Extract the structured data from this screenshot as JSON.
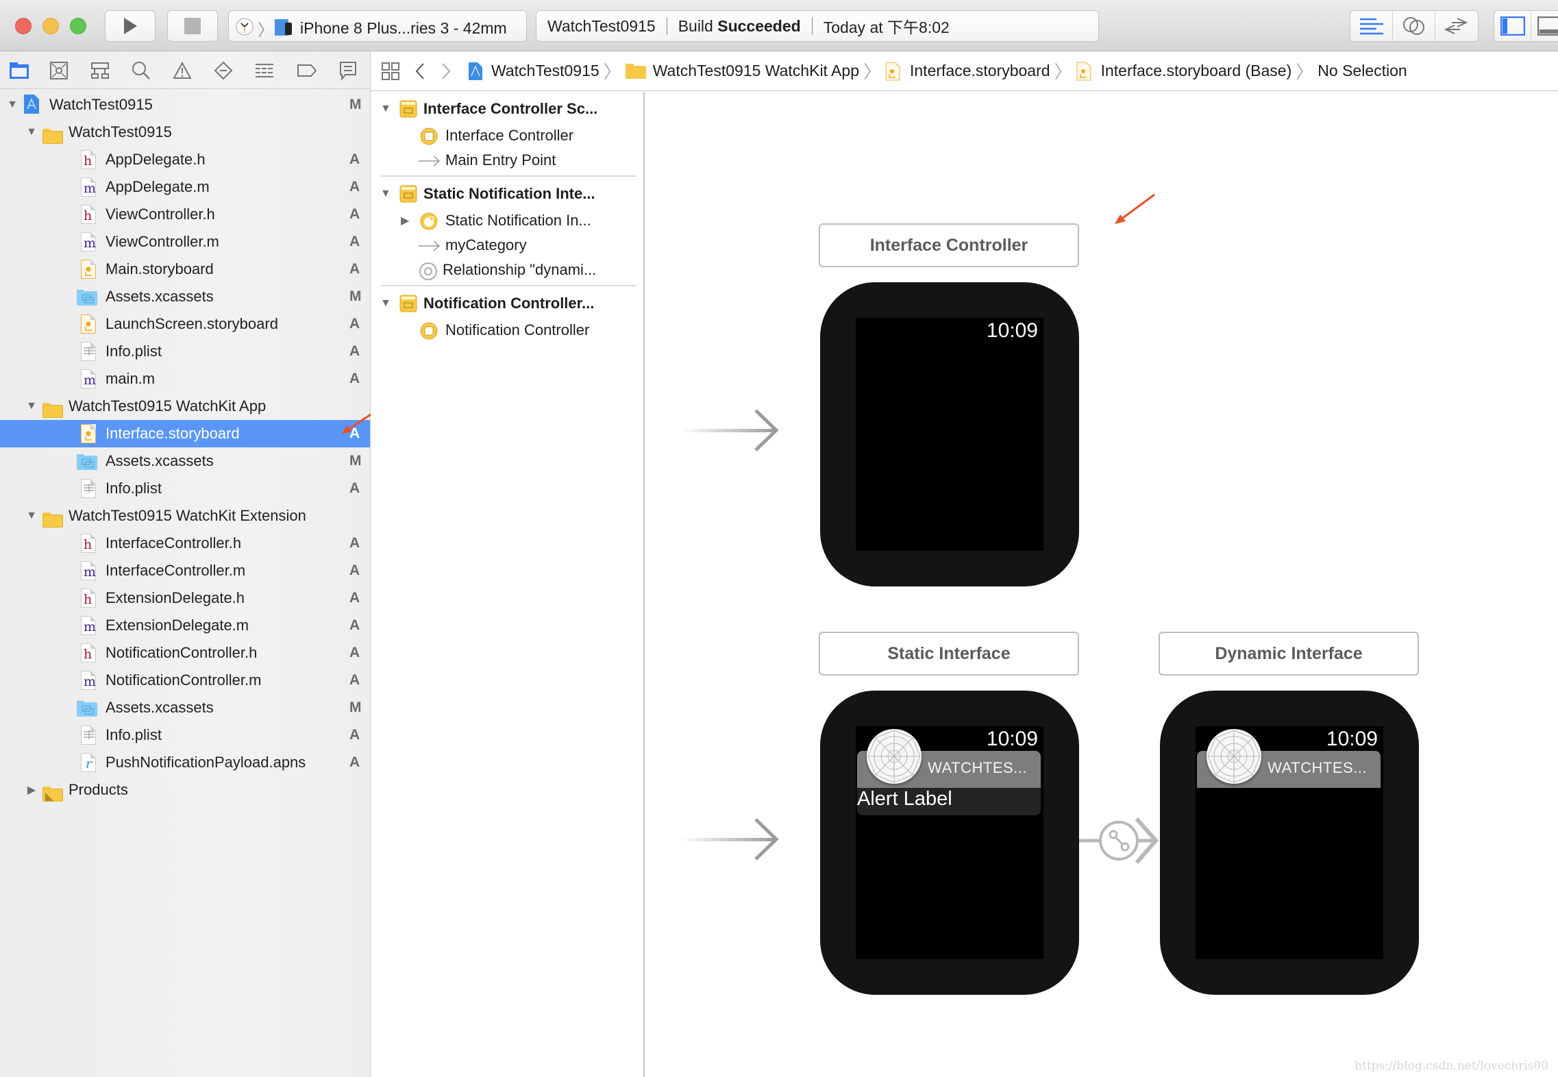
{
  "toolbar": {
    "window_controls": [
      "close",
      "minimize",
      "zoom"
    ],
    "run_button": "run",
    "stop_button": "stop",
    "scheme": "iPhone 8 Plus...ries 3 - 42mm",
    "activity": {
      "project": "WatchTest0915",
      "status_prefix": "Build",
      "status_bold": "Succeeded",
      "time": "Today at 下午8:02"
    },
    "editor_modes": [
      "standard-editor",
      "assistant-editor",
      "version-editor"
    ],
    "view_toggles": [
      "navigator",
      "debug-area"
    ]
  },
  "navigator": {
    "tabs": [
      "project",
      "source-control",
      "symbol",
      "find",
      "issue",
      "test",
      "debug",
      "breakpoint",
      "report"
    ],
    "tree": [
      {
        "label": "WatchTest0915",
        "type": "project",
        "level": 0,
        "expanded": true,
        "status": "M"
      },
      {
        "label": "WatchTest0915",
        "type": "folder",
        "level": 1,
        "expanded": true,
        "status": ""
      },
      {
        "label": "AppDelegate.h",
        "type": "h",
        "level": 2,
        "status": "A"
      },
      {
        "label": "AppDelegate.m",
        "type": "m",
        "level": 2,
        "status": "A"
      },
      {
        "label": "ViewController.h",
        "type": "h",
        "level": 2,
        "status": "A"
      },
      {
        "label": "ViewController.m",
        "type": "m",
        "level": 2,
        "status": "A"
      },
      {
        "label": "Main.storyboard",
        "type": "storyboard",
        "level": 2,
        "status": "A"
      },
      {
        "label": "Assets.xcassets",
        "type": "assets",
        "level": 2,
        "status": "M"
      },
      {
        "label": "LaunchScreen.storyboard",
        "type": "storyboard",
        "level": 2,
        "status": "A"
      },
      {
        "label": "Info.plist",
        "type": "plist",
        "level": 2,
        "status": "A"
      },
      {
        "label": "main.m",
        "type": "m",
        "level": 2,
        "status": "A"
      },
      {
        "label": "WatchTest0915 WatchKit App",
        "type": "folder",
        "level": 1,
        "expanded": true,
        "status": ""
      },
      {
        "label": "Interface.storyboard",
        "type": "storyboard",
        "level": 2,
        "status": "A",
        "selected": true
      },
      {
        "label": "Assets.xcassets",
        "type": "assets",
        "level": 2,
        "status": "M"
      },
      {
        "label": "Info.plist",
        "type": "plist",
        "level": 2,
        "status": "A"
      },
      {
        "label": "WatchTest0915 WatchKit Extension",
        "type": "folder",
        "level": 1,
        "expanded": true,
        "status": ""
      },
      {
        "label": "InterfaceController.h",
        "type": "h",
        "level": 2,
        "status": "A"
      },
      {
        "label": "InterfaceController.m",
        "type": "m",
        "level": 2,
        "status": "A"
      },
      {
        "label": "ExtensionDelegate.h",
        "type": "h",
        "level": 2,
        "status": "A"
      },
      {
        "label": "ExtensionDelegate.m",
        "type": "m",
        "level": 2,
        "status": "A"
      },
      {
        "label": "NotificationController.h",
        "type": "h",
        "level": 2,
        "status": "A"
      },
      {
        "label": "NotificationController.m",
        "type": "m",
        "level": 2,
        "status": "A"
      },
      {
        "label": "Assets.xcassets",
        "type": "assets",
        "level": 2,
        "status": "M"
      },
      {
        "label": "Info.plist",
        "type": "plist",
        "level": 2,
        "status": "A"
      },
      {
        "label": "PushNotificationPayload.apns",
        "type": "apns",
        "level": 2,
        "status": "A"
      },
      {
        "label": "Products",
        "type": "products",
        "level": 1,
        "expanded": false,
        "status": ""
      }
    ]
  },
  "jumpbar": {
    "crumbs": [
      {
        "label": "WatchTest0915",
        "icon": "project"
      },
      {
        "label": "WatchTest0915 WatchKit App",
        "icon": "folder"
      },
      {
        "label": "Interface.storyboard",
        "icon": "storyboard"
      },
      {
        "label": "Interface.storyboard (Base)",
        "icon": "storyboard"
      },
      {
        "label": "No Selection",
        "icon": ""
      }
    ]
  },
  "outline": {
    "scenes": [
      {
        "label": "Interface Controller Sc...",
        "items": [
          {
            "label": "Interface Controller",
            "icon": "controller",
            "disclosure": false
          },
          {
            "label": "Main Entry Point",
            "icon": "arrow",
            "disclosure": false
          }
        ]
      },
      {
        "label": "Static Notification Inte...",
        "items": [
          {
            "label": "Static Notification In...",
            "icon": "notification",
            "disclosure": true
          },
          {
            "label": "myCategory",
            "icon": "arrow",
            "disclosure": false
          },
          {
            "label": "Relationship \"dynami...",
            "icon": "relationship",
            "disclosure": false
          }
        ]
      },
      {
        "label": "Notification Controller...",
        "items": [
          {
            "label": "Notification Controller",
            "icon": "controller",
            "disclosure": false
          }
        ]
      }
    ]
  },
  "canvas": {
    "scenes": [
      {
        "title": "Interface Controller",
        "time": "10:09",
        "type": "plain"
      },
      {
        "title": "Static Interface",
        "time": "10:09",
        "type": "static",
        "app_name": "WATCHTES...",
        "alert_label": "Alert Label"
      },
      {
        "title": "Dynamic Interface",
        "time": "10:09",
        "type": "dynamic",
        "app_name": "WATCHTES..."
      }
    ],
    "annotation_color": "#e8512b"
  },
  "watermark": "https://blog.csdn.net/lovechris00",
  "colors": {
    "selection": "#5a96f5",
    "accent": "#3478f6",
    "folder": "#f7c945",
    "h_file": "#a3192b",
    "m_file": "#3e2388"
  }
}
